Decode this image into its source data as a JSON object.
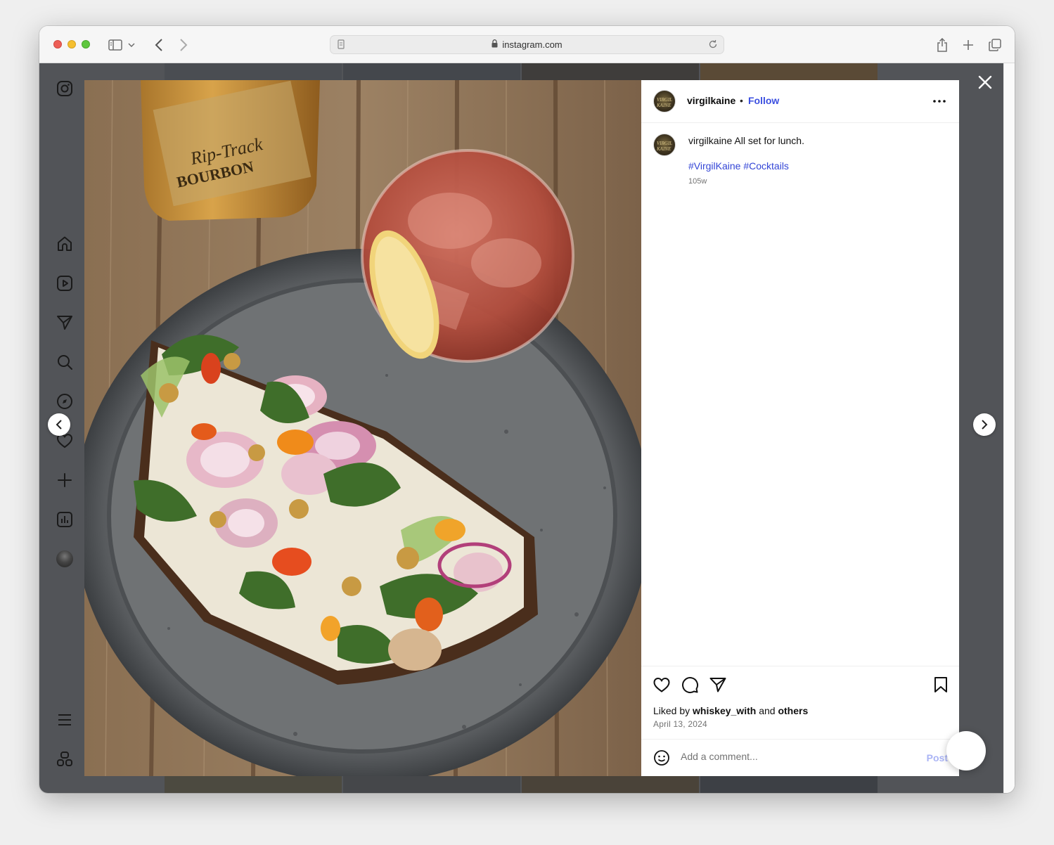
{
  "browser": {
    "url": "instagram.com"
  },
  "post": {
    "username": "virgilkaine",
    "separator": "•",
    "follow_label": "Follow",
    "avatar_text": "VIRGIL KAINE",
    "caption_user": "virgilkaine",
    "caption_text": "All set for lunch.",
    "hashtags": "#VirgilKaine #Cocktails",
    "age": "105w",
    "liked_prefix": "Liked by",
    "liked_user": "whiskey_with",
    "liked_and": "and",
    "liked_others": "others",
    "date": "April 13, 2024",
    "comment_placeholder": "Add a comment...",
    "post_label": "Post",
    "photo_bottle_label": "BOURBON",
    "photo_bottle_brand": "Rip-Track"
  },
  "colors": {
    "accent": "#3b4fe0",
    "link": "#3345d6",
    "overlay": "#525458"
  },
  "icons": {
    "sidebar": [
      "instagram-logo-icon",
      "home-icon",
      "reels-icon",
      "direct-icon",
      "search-icon",
      "explore-icon",
      "heart-icon",
      "create-icon",
      "insights-icon",
      "profile-avatar",
      "more-menu-icon",
      "also-from-meta-icon"
    ],
    "actions": [
      "like-icon",
      "comment-icon",
      "share-icon",
      "save-icon"
    ]
  }
}
